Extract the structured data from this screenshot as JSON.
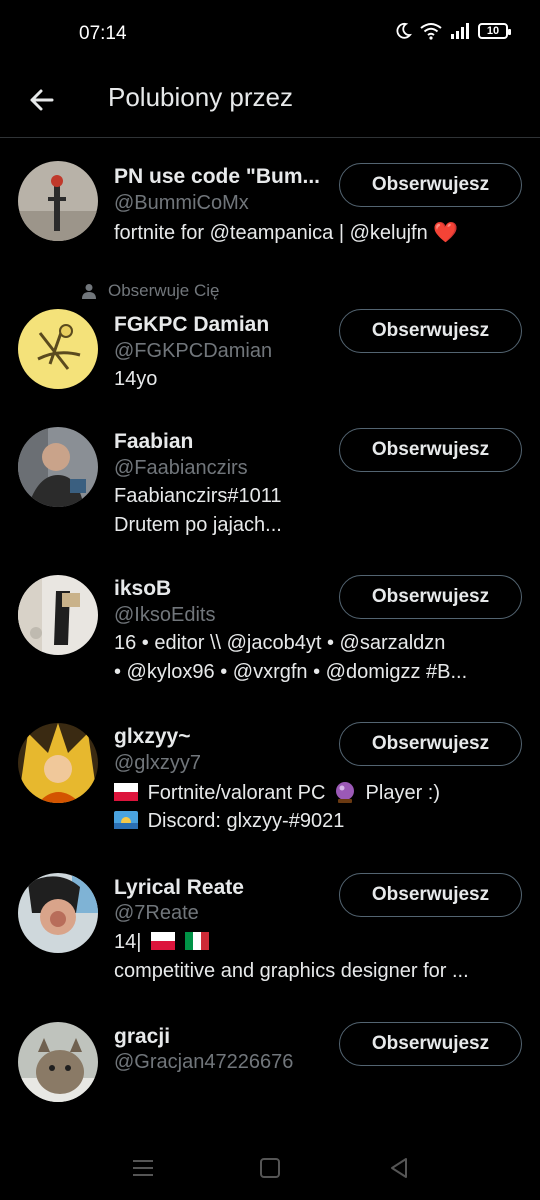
{
  "status": {
    "time": "07:14",
    "battery": "10"
  },
  "header": {
    "title": "Polubiony przez"
  },
  "users": [
    {
      "name": "PN use code \"Bum...",
      "handle": "@BummiCoMx",
      "bio_lines": [
        "fortnite for @teampanica | @kelujfn ❤️"
      ],
      "button": "Obserwujesz"
    },
    {
      "follows_you": "Obserwuje Cię",
      "name": "FGKPC Damian",
      "handle": "@FGKPCDamian",
      "bio_lines": [
        "14yo"
      ],
      "button": "Obserwujesz"
    },
    {
      "name": "Faabian",
      "handle": "@Faabianczirs",
      "bio_lines": [
        "Faabianczirs#1011",
        "Drutem po jajach..."
      ],
      "button": "Obserwujesz"
    },
    {
      "name": "iksoB",
      "handle": "@IksoEdits",
      "bio_lines": [
        "16 • editor \\\\ @jacob4yt • @sarzaldzn",
        "• @kylox96 • @vxrgfn  • @domigzz  #B..."
      ],
      "button": "Obserwujesz"
    },
    {
      "name": "glxzyy~",
      "handle": "@glxzyy7",
      "bio_lines": [
        "Fortnite/valorant PC",
        "Player :)",
        "Discord: glxzyy-#9021"
      ],
      "button": "Obserwujesz"
    },
    {
      "name": "Lyrical Reate",
      "handle": "@7Reate",
      "bio_lines": [
        "14|",
        "competitive and graphics designer for ..."
      ],
      "button": "Obserwujesz"
    },
    {
      "name": "gracji",
      "handle": "@Gracjan47226676",
      "bio_lines": [],
      "button": "Obserwujesz"
    }
  ]
}
